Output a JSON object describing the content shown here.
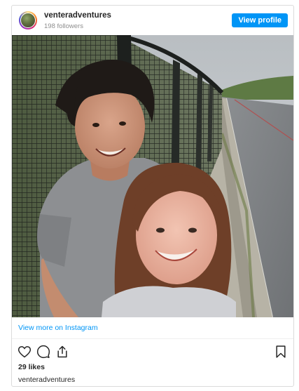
{
  "post": {
    "username": "venteradventures",
    "followers": "198 followers",
    "view_profile_label": "View profile",
    "view_more_label": "View more on Instagram",
    "likes": "29 likes",
    "caption_username": "venteradventures"
  },
  "icons": {
    "like": "heart-icon",
    "comment": "comment-icon",
    "share": "share-icon",
    "save": "bookmark-icon"
  },
  "colors": {
    "accent": "#0095f6",
    "border": "#dbdbdb",
    "text": "#262626",
    "muted": "#8e8e8e"
  }
}
